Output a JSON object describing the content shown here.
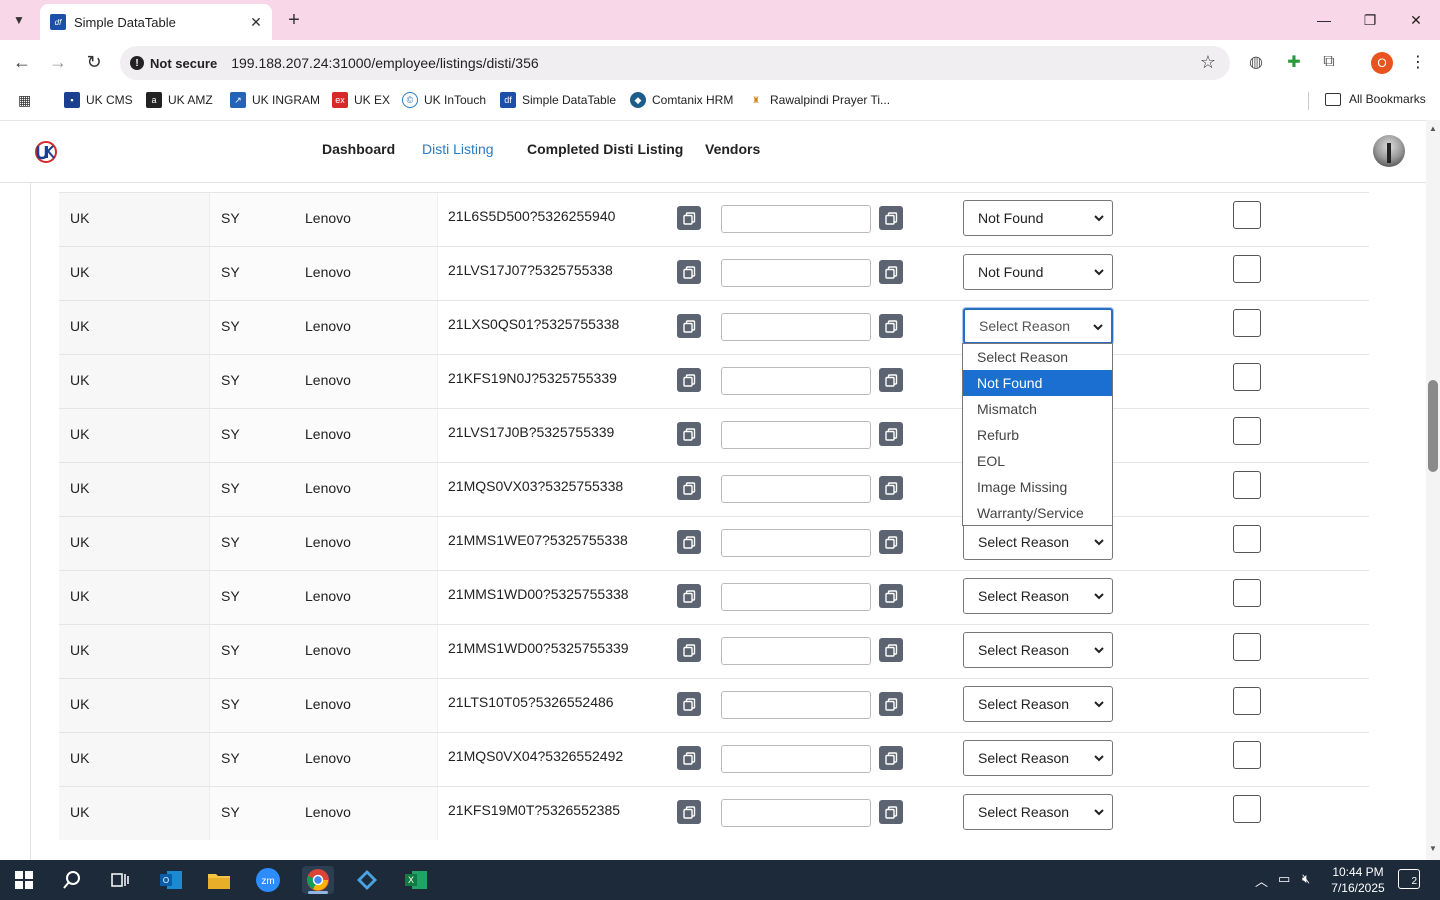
{
  "browser": {
    "tab_title": "Simple DataTable",
    "tab_favicon": "df",
    "security_label": "Not secure",
    "url": "199.188.207.24:31000/employee/listings/disti/356",
    "profile_initial": "O"
  },
  "bookmarks": {
    "items": [
      {
        "label": "UK CMS"
      },
      {
        "label": "UK AMZ"
      },
      {
        "label": "UK INGRAM"
      },
      {
        "label": "UK EX"
      },
      {
        "label": "UK InTouch"
      },
      {
        "label": "Simple DataTable"
      },
      {
        "label": "Comtanix HRM"
      },
      {
        "label": "Rawalpindi Prayer Ti..."
      }
    ],
    "all_label": "All Bookmarks"
  },
  "nav": {
    "links": [
      "Dashboard",
      "Disti Listing",
      "Completed Disti Listing",
      "Vendors"
    ],
    "active": "Disti Listing"
  },
  "table": {
    "rows": [
      {
        "region": "UK",
        "code": "SY",
        "brand": "Lenovo",
        "sku": "21L6S5D500?5326255940",
        "reason": "Not Found"
      },
      {
        "region": "UK",
        "code": "SY",
        "brand": "Lenovo",
        "sku": "21LVS17J07?5325755338",
        "reason": "Not Found"
      },
      {
        "region": "UK",
        "code": "SY",
        "brand": "Lenovo",
        "sku": "21LXS0QS01?5325755338",
        "reason": "Select Reason"
      },
      {
        "region": "UK",
        "code": "SY",
        "brand": "Lenovo",
        "sku": "21KFS19N0J?5325755339",
        "reason": ""
      },
      {
        "region": "UK",
        "code": "SY",
        "brand": "Lenovo",
        "sku": "21LVS17J0B?5325755339",
        "reason": ""
      },
      {
        "region": "UK",
        "code": "SY",
        "brand": "Lenovo",
        "sku": "21MQS0VX03?5325755338",
        "reason": ""
      },
      {
        "region": "UK",
        "code": "SY",
        "brand": "Lenovo",
        "sku": "21MMS1WE07?5325755338",
        "reason": "Select Reason"
      },
      {
        "region": "UK",
        "code": "SY",
        "brand": "Lenovo",
        "sku": "21MMS1WD00?5325755338",
        "reason": "Select Reason"
      },
      {
        "region": "UK",
        "code": "SY",
        "brand": "Lenovo",
        "sku": "21MMS1WD00?5325755339",
        "reason": "Select Reason"
      },
      {
        "region": "UK",
        "code": "SY",
        "brand": "Lenovo",
        "sku": "21LTS10T05?5326552486",
        "reason": "Select Reason"
      },
      {
        "region": "UK",
        "code": "SY",
        "brand": "Lenovo",
        "sku": "21MQS0VX04?5326552492",
        "reason": "Select Reason"
      },
      {
        "region": "UK",
        "code": "SY",
        "brand": "Lenovo",
        "sku": "21KFS19M0T?5326552385",
        "reason": "Select Reason"
      }
    ]
  },
  "dropdown": {
    "options": [
      "Select Reason",
      "Not Found",
      "Mismatch",
      "Refurb",
      "EOL",
      "Image Missing",
      "Warranty/Service"
    ],
    "highlighted": "Not Found"
  },
  "taskbar": {
    "time": "10:44 PM",
    "date": "7/16/2025",
    "notification_count": "2"
  },
  "colors": {
    "accent": "#1a6fd1",
    "nav_active": "#2b7bbd",
    "titlebar": "#f8d7e8",
    "taskbar": "#1c2a3a"
  }
}
